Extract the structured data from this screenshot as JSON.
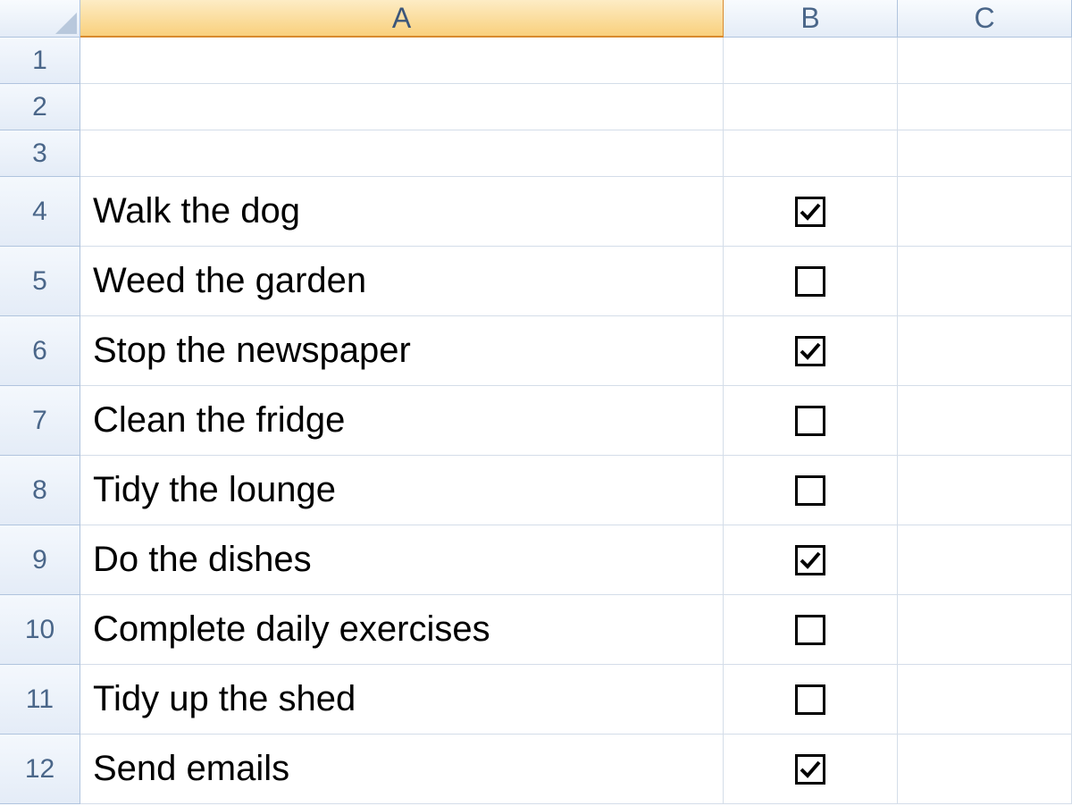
{
  "columns": [
    "A",
    "B",
    "C"
  ],
  "activeColumn": "A",
  "emptyRows": [
    1,
    2,
    3
  ],
  "dataRows": [
    {
      "row": 4,
      "task": "Walk the dog",
      "checked": true
    },
    {
      "row": 5,
      "task": "Weed the garden",
      "checked": false
    },
    {
      "row": 6,
      "task": "Stop the newspaper",
      "checked": true
    },
    {
      "row": 7,
      "task": "Clean the fridge",
      "checked": false
    },
    {
      "row": 8,
      "task": "Tidy the lounge",
      "checked": false
    },
    {
      "row": 9,
      "task": "Do the dishes",
      "checked": true
    },
    {
      "row": 10,
      "task": "Complete daily exercises",
      "checked": false
    },
    {
      "row": 11,
      "task": "Tidy up the shed",
      "checked": false
    },
    {
      "row": 12,
      "task": "Send emails",
      "checked": true
    }
  ]
}
